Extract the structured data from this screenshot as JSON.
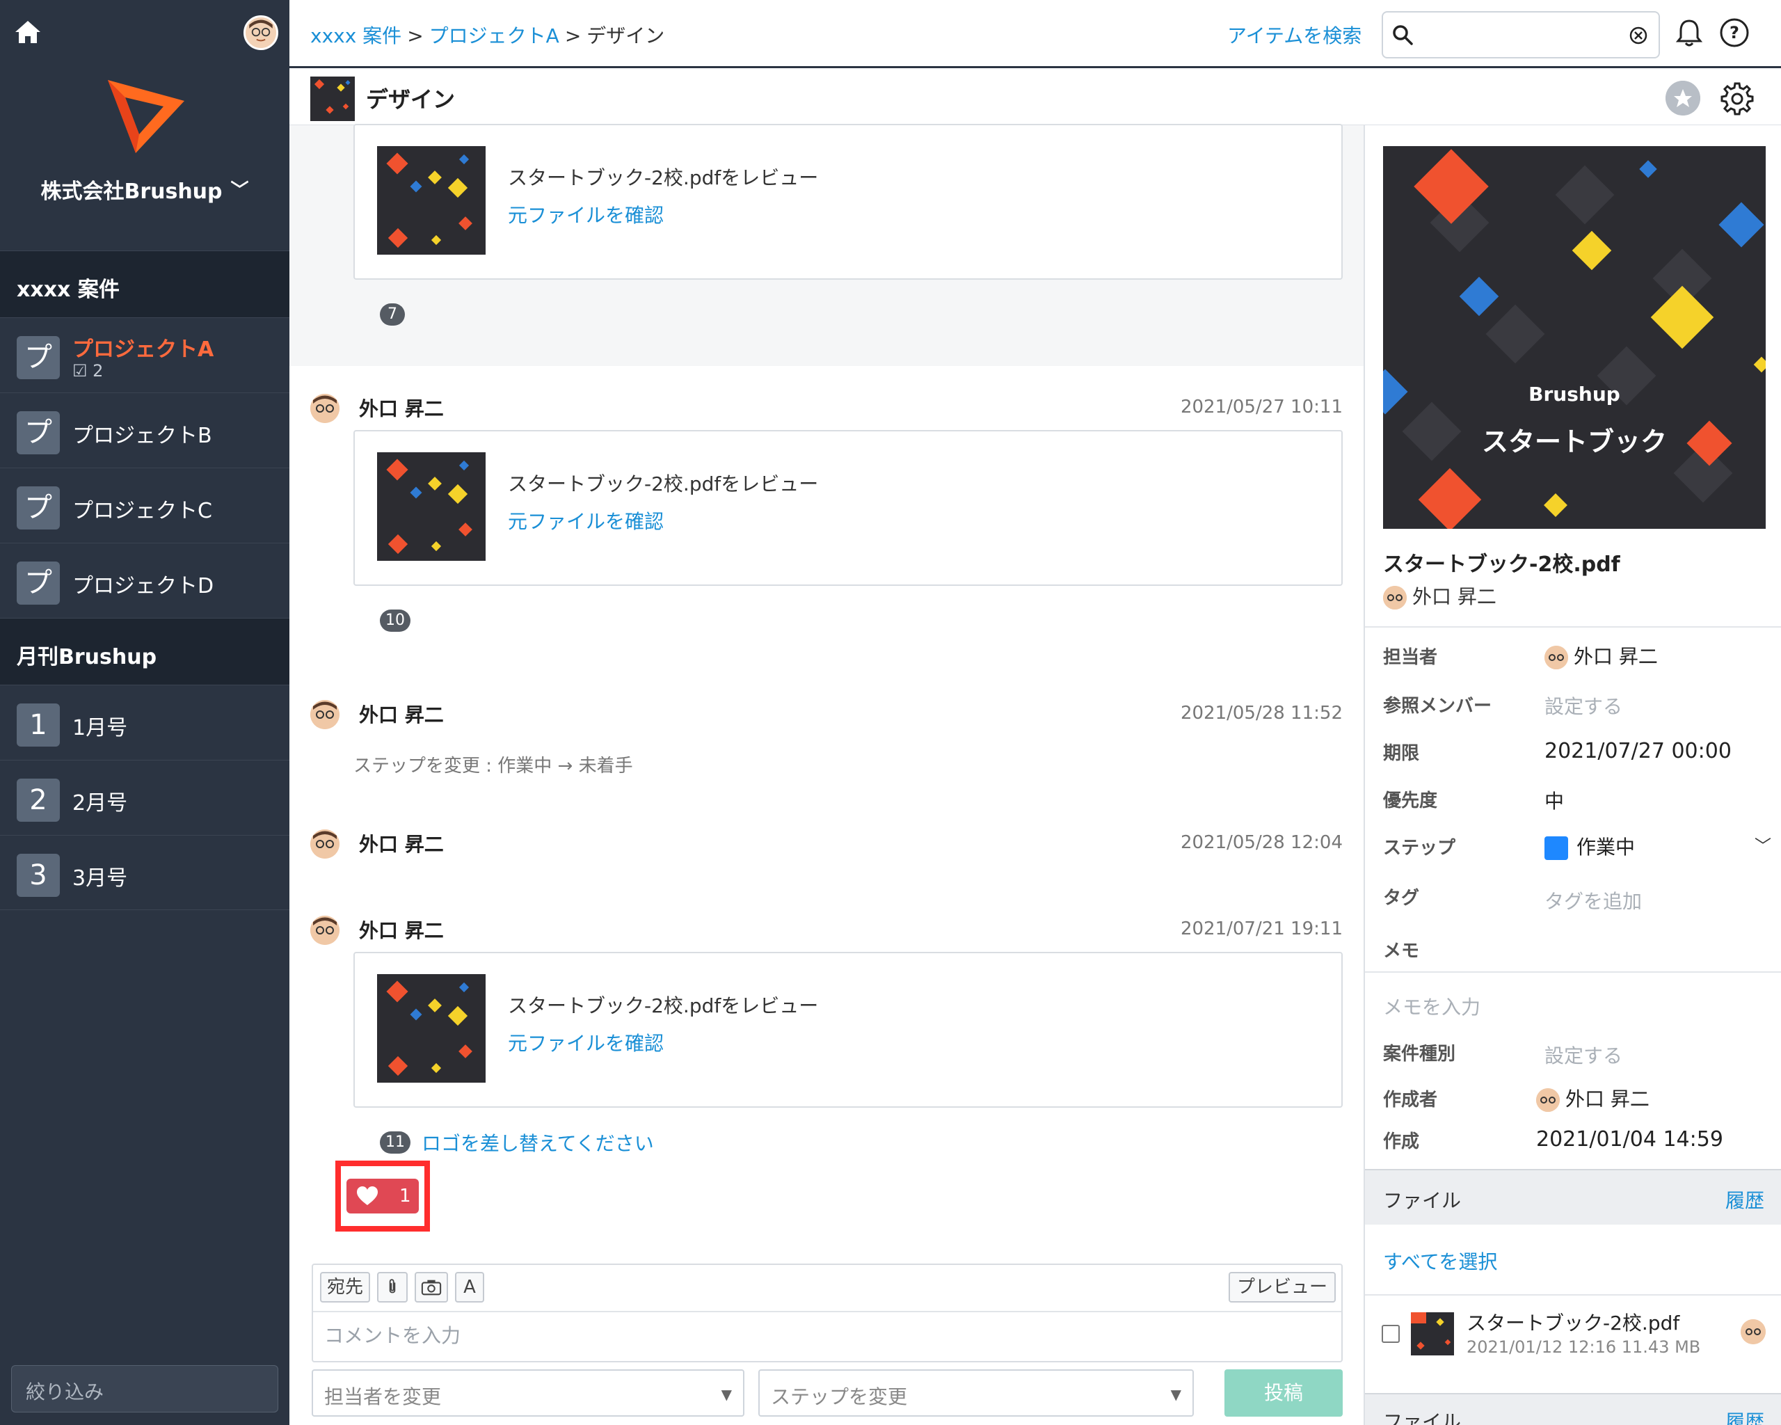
{
  "sidebar": {
    "company": "株式会社Brushup",
    "sections": [
      {
        "title": "xxxx 案件"
      },
      {
        "title": "月刊Brushup"
      }
    ],
    "projects": [
      {
        "badge": "プ",
        "label": "プロジェクトA",
        "sub": "2"
      },
      {
        "badge": "プ",
        "label": "プロジェクトB"
      },
      {
        "badge": "プ",
        "label": "プロジェクトC"
      },
      {
        "badge": "プ",
        "label": "プロジェクトD"
      }
    ],
    "issues": [
      {
        "badge": "1",
        "label": "1月号"
      },
      {
        "badge": "2",
        "label": "2月号"
      },
      {
        "badge": "3",
        "label": "3月号"
      }
    ],
    "filter_placeholder": "絞り込み"
  },
  "header": {
    "crumb1": "xxxx 案件",
    "crumb2": "プロジェクトA",
    "crumb3": "デザイン",
    "search_link": "アイテムを検索"
  },
  "titlebar": {
    "title": "デザイン"
  },
  "feed": {
    "review_title": "スタートブック-2校.pdfをレビュー",
    "review_link": "元ファイルを確認",
    "author": "外口 昇二",
    "entries": [
      {
        "num": "7"
      },
      {
        "date": "2021/05/27 10:11",
        "num": "10"
      },
      {
        "date": "2021/05/28 11:52",
        "text": "ステップを変更 : 作業中 → 未着手"
      },
      {
        "date": "2021/05/28 12:04"
      },
      {
        "date": "2021/07/21 19:11",
        "num": "11",
        "comment": "ロゴを差し替えてください"
      }
    ],
    "like_count": "1"
  },
  "composer": {
    "to_label": "宛先",
    "font_label": "A",
    "preview_label": "プレビュー",
    "placeholder": "コメントを入力",
    "assignee_placeholder": "担当者を変更",
    "step_placeholder": "ステップを変更",
    "post_label": "投稿"
  },
  "panel": {
    "preview_brand": "Brushup",
    "preview_title": "スタートブック",
    "file_name": "スタートブック-2校.pdf",
    "author": "外口 昇二",
    "props": {
      "assignee_label": "担当者",
      "assignee": "外口 昇二",
      "members_label": "参照メンバー",
      "members": "設定する",
      "due_label": "期限",
      "due": "2021/07/27 00:00",
      "priority_label": "優先度",
      "priority": "中",
      "step_label": "ステップ",
      "step": "作業中",
      "tag_label": "タグ",
      "tag": "タグを追加",
      "memo_label": "メモ",
      "memo": "メモを入力",
      "type_label": "案件種別",
      "type": "設定する",
      "creator_label": "作成者",
      "creator": "外口 昇二",
      "created_label": "作成",
      "created": "2021/01/04 14:59"
    },
    "files_title": "ファイル",
    "history_label": "履歴",
    "select_all": "すべてを選択",
    "file_row": {
      "name": "スタートブック-2校.pdf",
      "meta": "2021/01/12 12:16 11.43 MB"
    }
  },
  "colors": {
    "sidebar_bg": "#2b3442",
    "accent_orange": "#ff6a3d",
    "link_blue": "#1a8fd6",
    "like_red": "#e04854",
    "step_blue": "#1e88ff",
    "post_green": "#8fd7c4"
  }
}
